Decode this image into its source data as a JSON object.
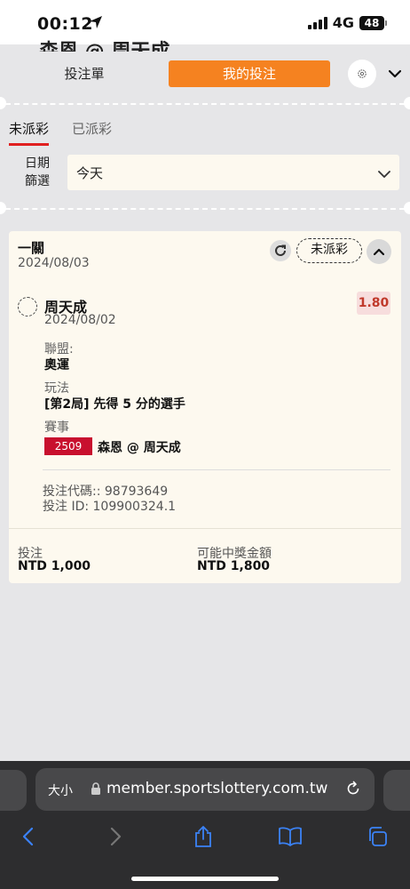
{
  "status_bar": {
    "time": "00:12",
    "network": "4G",
    "battery": "48"
  },
  "peek_title": "森恩 @ 周天成",
  "tabs": {
    "slip": "投注單",
    "my_bets": "我的投注"
  },
  "subtabs": {
    "unsettled": "未派彩",
    "settled": "已派彩"
  },
  "date_filter": {
    "label": "日期篩選",
    "value": "今天"
  },
  "bet": {
    "type": "一關",
    "date": "2024/08/03",
    "status": "未派彩",
    "selection": "周天成",
    "selection_date": "2024/08/02",
    "odds": "1.80",
    "league_label": "聯盟:",
    "league": "奧運",
    "market_label": "玩法",
    "market": "[第2局] 先得 5 分的選手",
    "event_label": "賽事",
    "event_code": "2509",
    "event": "森恩 @ 周天成",
    "bet_code": "投注代碼:: 98793649",
    "bet_id": "投注 ID: 109900324.1",
    "stake_label": "投注",
    "stake": "NTD 1,000",
    "payout_label": "可能中獎金額",
    "payout": "NTD 1,800"
  },
  "browser": {
    "text_size": "大小",
    "url": "member.sportslottery.com.tw"
  },
  "colors": {
    "accent": "#f58220",
    "badge": "#c8102e",
    "active_underline": "#e02020"
  }
}
